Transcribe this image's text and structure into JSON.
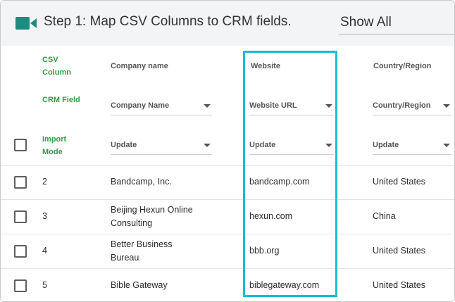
{
  "header": {
    "title": "Step 1: Map CSV Columns to CRM fields.",
    "show_all": "Show All",
    "icon": "video-camera-icon",
    "icon_color": "#1f8a80"
  },
  "row_labels": {
    "csv_column": "CSV Column",
    "crm_field": "CRM Field",
    "import_mode": "Import Mode"
  },
  "columns": [
    {
      "csv": "Company name",
      "crm": "Company Name",
      "mode": "Update"
    },
    {
      "csv": "Website",
      "crm": "Website URL",
      "mode": "Update"
    },
    {
      "csv": "Country/Region",
      "crm": "Country/Region",
      "mode": "Update"
    }
  ],
  "rows": [
    {
      "num": "2",
      "company": "Bandcamp, Inc.",
      "website": "bandcamp.com",
      "country": "United States"
    },
    {
      "num": "3",
      "company": "Beijing Hexun Online Consulting",
      "website": "hexun.com",
      "country": "China"
    },
    {
      "num": "4",
      "company": "Better Business Bureau",
      "website": "bbb.org",
      "country": "United States"
    },
    {
      "num": "5",
      "company": "Bible Gateway",
      "website": "biblegateway.com",
      "country": "United States"
    }
  ],
  "highlight_color": "#18bcd4",
  "label_color": "#2e9e4a"
}
